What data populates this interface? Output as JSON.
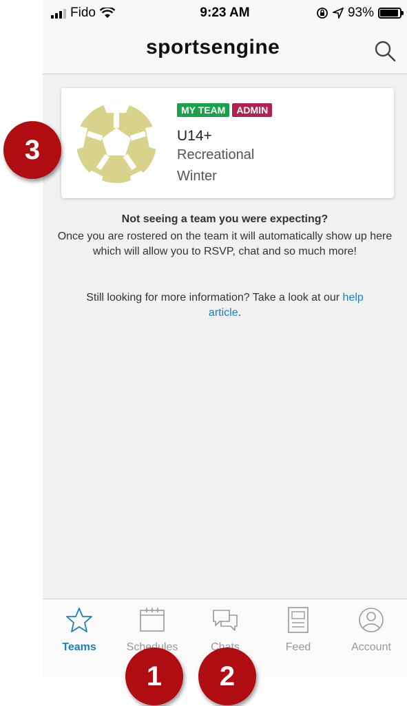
{
  "status_bar": {
    "carrier": "Fido",
    "time": "9:23 AM",
    "battery": "93%"
  },
  "header": {
    "logo": "sportsengine"
  },
  "team_card": {
    "badges": [
      "MY TEAM",
      "ADMIN"
    ],
    "name": "U14+",
    "line1": "Recreational",
    "line2": "Winter"
  },
  "message": {
    "title": "Not seeing a team you were expecting?",
    "body": "Once you are rostered on the team it will automatically show up here which will allow you to RSVP, chat and so much more!",
    "more_prefix": "Still looking for more information? Take a look at our ",
    "link": "help article",
    "more_suffix": "."
  },
  "tabs": [
    {
      "label": "Teams",
      "icon": "star-icon",
      "active": true
    },
    {
      "label": "Schedules",
      "icon": "calendar-icon",
      "active": false
    },
    {
      "label": "Chats",
      "icon": "chat-icon",
      "active": false
    },
    {
      "label": "Feed",
      "icon": "feed-icon",
      "active": false
    },
    {
      "label": "Account",
      "icon": "account-icon",
      "active": false
    }
  ],
  "callouts": [
    "1",
    "2",
    "3"
  ],
  "colors": {
    "accent": "#1c7ec0",
    "badge_green": "#1aa24b",
    "badge_red": "#b0244c",
    "callout": "#b00d12",
    "ball": "#d7d28c"
  }
}
